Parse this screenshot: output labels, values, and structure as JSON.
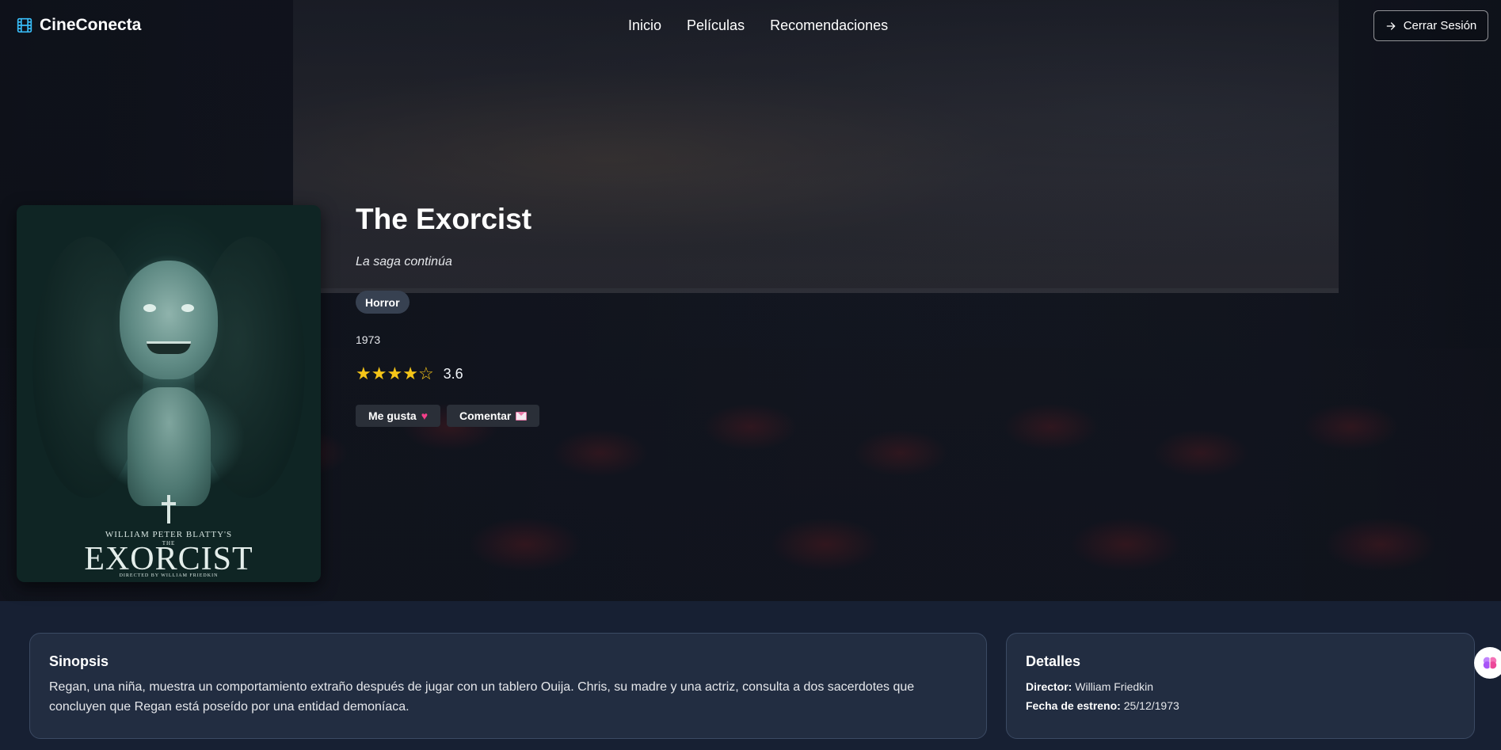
{
  "brand": {
    "name": "CineConecta",
    "icon": "film-icon",
    "accent": "#38bdf8"
  },
  "nav": {
    "links": [
      {
        "label": "Inicio"
      },
      {
        "label": "Películas"
      },
      {
        "label": "Recomendaciones"
      }
    ]
  },
  "logout": {
    "label": "Cerrar Sesión",
    "icon": "arrow-right-icon"
  },
  "poster": {
    "byline": "WILLIAM PETER BLATTY'S",
    "the": "THE",
    "title": "EXORCIST",
    "director_credit": "DIRECTED BY WILLIAM FRIEDKIN"
  },
  "movie": {
    "title": "The Exorcist",
    "tagline": "La saga continúa",
    "genre": "Horror",
    "year": "1973",
    "rating": "3.6",
    "rating_value": 3.6,
    "stars_max": 5,
    "star_color": "#f5c518"
  },
  "actions": {
    "like_label": "Me gusta",
    "like_icon": "heart-icon",
    "comment_label": "Comentar",
    "comment_icon": "envelope-icon"
  },
  "synopsis": {
    "title": "Sinopsis",
    "text": "Regan, una niña, muestra un comportamiento extraño después de jugar con un tablero Ouija. Chris, su madre y una actriz, consulta a dos sacerdotes que concluyen que Regan está poseído por una entidad demoníaca."
  },
  "details": {
    "title": "Detalles",
    "director_label": "Director:",
    "director": "William Friedkin",
    "release_label": "Fecha de estreno:",
    "release": "25/12/1973"
  },
  "floating": {
    "icon": "brain-icon"
  }
}
